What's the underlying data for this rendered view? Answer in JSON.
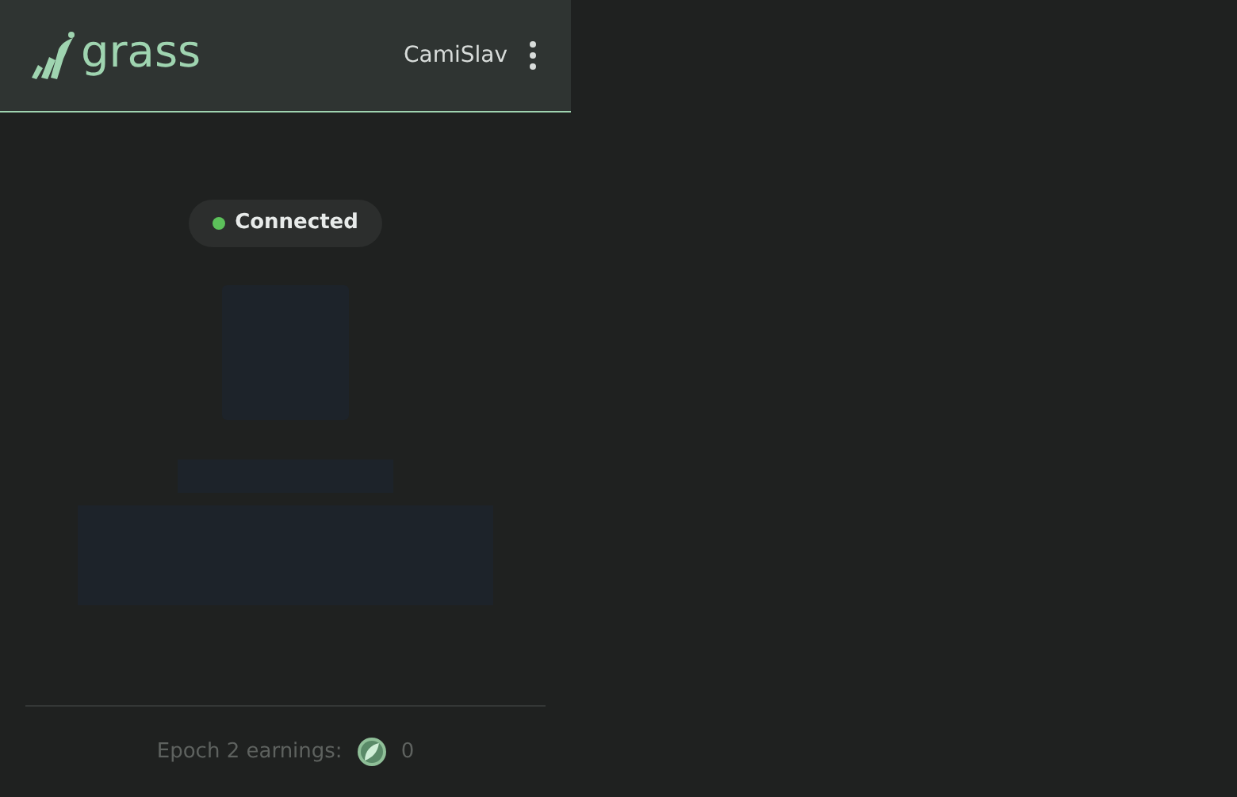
{
  "header": {
    "logo_text": "grass",
    "username": "CamiSlav"
  },
  "status": {
    "label": "Connected",
    "connected": true
  },
  "footer": {
    "earnings_label": "Epoch 2 earnings:",
    "earnings_value": "0"
  }
}
